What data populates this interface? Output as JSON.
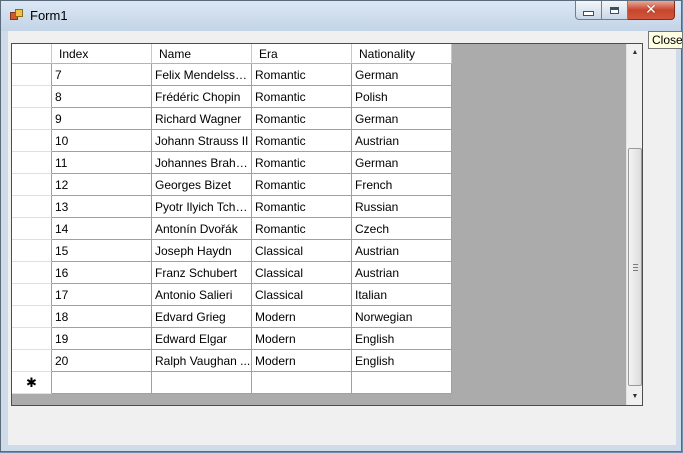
{
  "window": {
    "title": "Form1"
  },
  "tooltip": {
    "text": "Close"
  },
  "grid": {
    "columns": [
      "Index",
      "Name",
      "Era",
      "Nationality"
    ],
    "rows": [
      [
        "7",
        "Felix Mendelssohn",
        "Romantic",
        "German"
      ],
      [
        "8",
        "Frédéric Chopin",
        "Romantic",
        "Polish"
      ],
      [
        "9",
        "Richard Wagner",
        "Romantic",
        "German"
      ],
      [
        "10",
        "Johann Strauss II",
        "Romantic",
        "Austrian"
      ],
      [
        "11",
        "Johannes Brahms",
        "Romantic",
        "German"
      ],
      [
        "12",
        "Georges Bizet",
        "Romantic",
        "French"
      ],
      [
        "13",
        "Pyotr Ilyich Tchai...",
        "Romantic",
        "Russian"
      ],
      [
        "14",
        "Antonín Dvořák",
        "Romantic",
        "Czech"
      ],
      [
        "15",
        "Joseph Haydn",
        " Classical",
        "Austrian"
      ],
      [
        "16",
        "Franz Schubert",
        "Classical",
        "Austrian"
      ],
      [
        "17",
        "Antonio Salieri",
        "Classical",
        "Italian"
      ],
      [
        "18",
        "Edvard Grieg",
        "Modern",
        "Norwegian"
      ],
      [
        "19",
        "Edward Elgar",
        "Modern",
        "English"
      ],
      [
        "20",
        "Ralph Vaughan ...",
        "Modern",
        "English"
      ]
    ],
    "new_row_marker": "✱"
  },
  "icons": {
    "app": "form-app-icon",
    "minimize": "minimize-icon",
    "maximize": "maximize-icon",
    "close": "close-icon",
    "scroll_up": "scroll-up-arrow-icon",
    "scroll_down": "scroll-down-arrow-icon"
  },
  "colors": {
    "close_button": "#c7452c",
    "grid_background": "#ababab",
    "titlebar": "#c3d4e7"
  }
}
